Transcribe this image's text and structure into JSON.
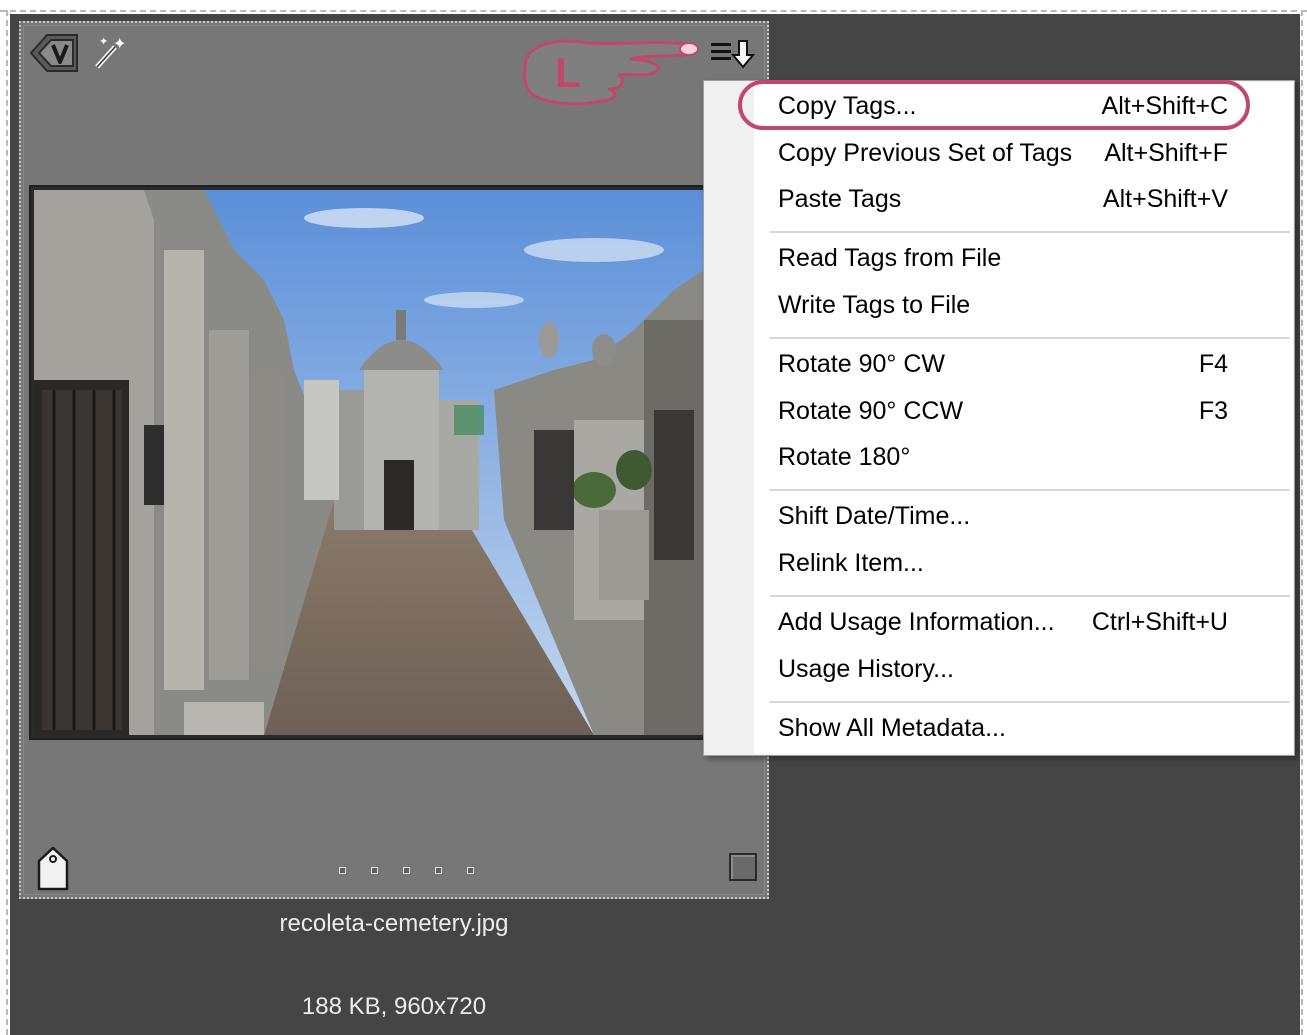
{
  "thumbnail": {
    "filename": "recoleta-cemetery.jpg",
    "details": "188 KB, 960x720",
    "top_icons": [
      "version-set-icon",
      "auto-fix-icon"
    ],
    "menu_icon": "hamburger-menu-icon",
    "callout_letter": "L",
    "bottom_icons": [
      "tag-icon",
      "rating-dots",
      "select-checkbox"
    ]
  },
  "context_menu": {
    "items": [
      {
        "label": "Copy Tags...",
        "shortcut": "Alt+Shift+C"
      },
      {
        "label": "Copy Previous Set of Tags",
        "shortcut": "Alt+Shift+F"
      },
      {
        "label": "Paste Tags",
        "shortcut": "Alt+Shift+V"
      },
      {
        "label": "Read Tags from File",
        "shortcut": ""
      },
      {
        "label": "Write Tags to File",
        "shortcut": ""
      },
      {
        "label": "Rotate 90° CW",
        "shortcut": "F4"
      },
      {
        "label": "Rotate 90° CCW",
        "shortcut": "F3"
      },
      {
        "label": "Rotate 180°",
        "shortcut": ""
      },
      {
        "label": "Shift Date/Time...",
        "shortcut": ""
      },
      {
        "label": "Relink Item...",
        "shortcut": ""
      },
      {
        "label": "Add Usage Information...",
        "shortcut": "Ctrl+Shift+U"
      },
      {
        "label": "Usage History...",
        "shortcut": ""
      },
      {
        "label": "Show All Metadata...",
        "shortcut": ""
      }
    ],
    "highlighted_item": "Copy Tags..."
  },
  "colors": {
    "highlight_oval": "#c2476c",
    "panel_background": "#454545",
    "thumbnail_background": "#777777"
  }
}
